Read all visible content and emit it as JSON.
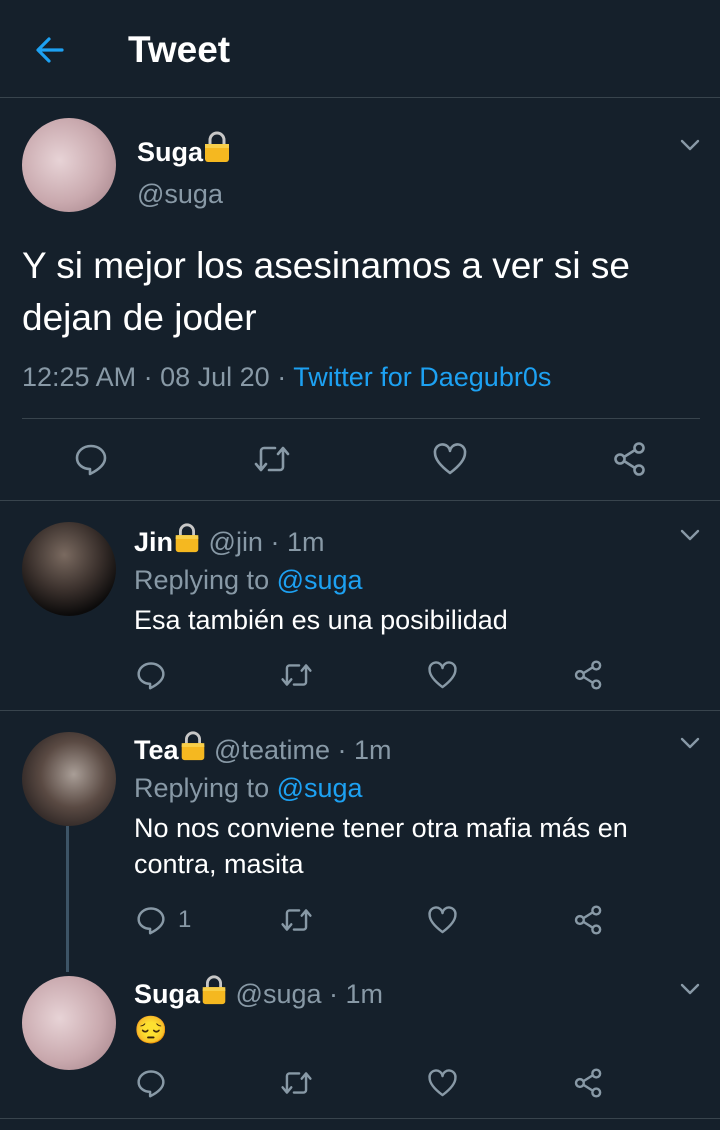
{
  "header": {
    "title": "Tweet",
    "back_icon": "arrow-left-icon"
  },
  "main_tweet": {
    "name": "Suga",
    "handle": "@suga",
    "text": "Y si mejor los asesinamos a ver si se dejan de joder",
    "time": "12:25 AM",
    "date": "08 Jul 20",
    "sep": "·",
    "source": "Twitter for Daegubr0s"
  },
  "replies": [
    {
      "name": "Jin",
      "handle": "@jin",
      "time": "1m",
      "replying_prefix": "Replying to",
      "replying_to": "@suga",
      "text": "Esa también es una posibilidad",
      "reply_count": ""
    },
    {
      "name": "Tea",
      "handle": "@teatime",
      "time": "1m",
      "replying_prefix": "Replying to",
      "replying_to": "@suga",
      "text": "No nos conviene tener otra mafia más en contra, masita",
      "reply_count": "1"
    },
    {
      "name": "Suga",
      "handle": "@suga",
      "time": "1m",
      "text": "😔",
      "reply_count": ""
    }
  ],
  "colors": {
    "background": "#15202b",
    "accent": "#1da1f2",
    "muted": "#8899a6",
    "divider": "#38444d"
  }
}
